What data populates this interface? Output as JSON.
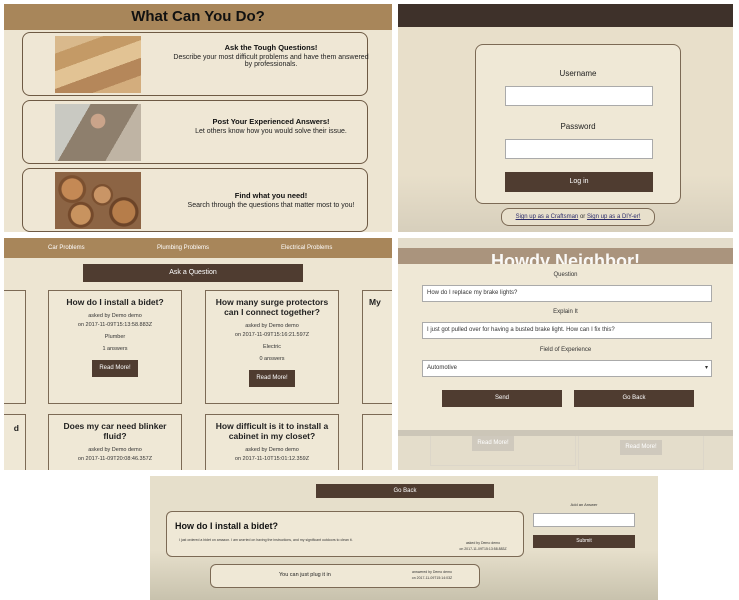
{
  "features": {
    "title": "What Can You Do?",
    "items": [
      {
        "title": "Ask the Tough Questions!",
        "desc": "Describe your most difficult problems and have them answered by professionals."
      },
      {
        "title": "Post Your Experienced Answers!",
        "desc": "Let others know how you would solve their issue."
      },
      {
        "title": "Find what you need!",
        "desc": "Search through the questions that matter most to you!"
      }
    ]
  },
  "login": {
    "username_label": "Username",
    "password_label": "Password",
    "login_button": "Log in",
    "signup_craftsman": "Sign up as a Craftsman",
    "signup_or": "or",
    "signup_diyer": "Sign up as a DIY-er!"
  },
  "questions": {
    "nav": [
      "Car Problems",
      "Plumbing Problems",
      "Electrical Problems"
    ],
    "ask_button": "Ask a Question",
    "read_more": "Read More!",
    "cards": [
      {
        "title": "How do I install a bidet?",
        "asked_by": "asked by Demo demo",
        "date": "on 2017-11-09T15:13:58.883Z",
        "field": "Plumber",
        "answers": "1 answers"
      },
      {
        "title": "How many surge protectors can I connect together?",
        "asked_by": "asked by Demo demo",
        "date": "on 2017-11-09T15:16:21.597Z",
        "field": "Electric",
        "answers": "0 answers"
      },
      {
        "title": "Does my car need blinker fluid?",
        "asked_by": "asked by Demo demo",
        "date": "on 2017-11-09T20:08:46.357Z"
      },
      {
        "title": "How difficult is it to install a cabinet in my closet?",
        "asked_by": "asked by Demo demo",
        "date": "on 2017-11-10T15:01:12.359Z"
      }
    ],
    "partial_right": "My",
    "partial_left": "d"
  },
  "ask_form": {
    "bg_title": "Howdy Neighbor!",
    "question_label": "Question",
    "question_value": "How do I replace my brake lights?",
    "explain_label": "Explain It",
    "explain_value": "I just got pulled over for having a busted brake light. How can I fix this?",
    "field_label": "Field of Experience",
    "field_value": "Automotive",
    "send_button": "Send",
    "goback_button": "Go Back",
    "ghost_button": "Read More!"
  },
  "detail": {
    "back_button": "Go Back",
    "question_title": "How do I install a bidet?",
    "question_body": "I just ordered a bidet on amazon. I am worried on having the instructions, and my significant outdoors to clean it.",
    "asked_by": "asked by Demo demo",
    "date": "on 2017-11-09T15:13:58.883Z",
    "answer_label": "Add an Answer",
    "submit_button": "Submit",
    "answer_text": "You can just plug it in",
    "answered_by": "answered by Demo demo",
    "answer_date": "on 2017-11-09T15:14:03Z"
  }
}
